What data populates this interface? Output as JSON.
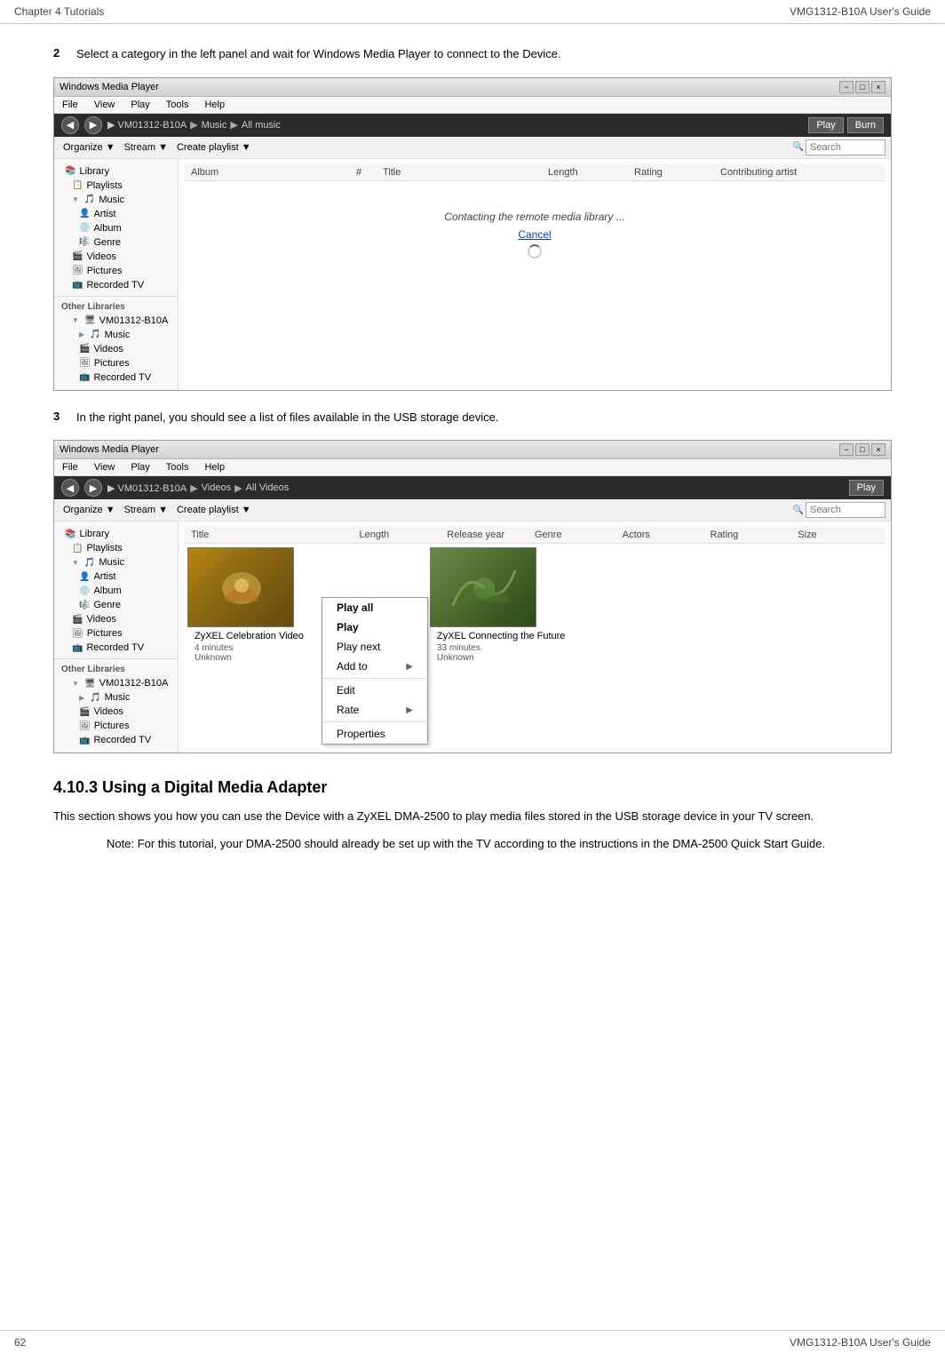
{
  "header": {
    "chapter": "Chapter 4 Tutorials",
    "product": "VMG1312-B10A User's Guide"
  },
  "footer": {
    "page": "62",
    "product": "VMG1312-B10A User's Guide"
  },
  "steps": {
    "step2": {
      "num": "2",
      "text": "Select a category in the left panel and wait for Windows Media Player to connect to the Device."
    },
    "step3": {
      "num": "3",
      "text": "In the right panel, you should see a list of files available in the USB storage device."
    }
  },
  "section": {
    "heading": "4.10.3  Using a Digital Media Adapter",
    "para1": "This section shows you how you can use the Device with a ZyXEL DMA-2500 to play media files stored in the USB storage device in your TV screen.",
    "note_label": "Note: ",
    "note_text": "For this tutorial, your DMA-2500 should already be set up with the TV according to the instructions in the DMA-2500 Quick Start Guide."
  },
  "wmp1": {
    "title": "Windows Media Player",
    "titlebar_minimize": "−",
    "titlebar_restore": "□",
    "titlebar_close": "×",
    "menu": [
      "File",
      "View",
      "Play",
      "Tools",
      "Help"
    ],
    "breadcrumb": [
      "VM01312-B10A",
      "Music",
      "All music"
    ],
    "btn_play": "Play",
    "btn_burn": "Burn",
    "toolbar_organize": "Organize ▼",
    "toolbar_stream": "Stream ▼",
    "toolbar_playlist": "Create playlist ▼",
    "search_placeholder": "Search",
    "col_headers": [
      "Album",
      "#",
      "Title",
      "Length",
      "Rating",
      "Contributing artist"
    ],
    "sidebar": {
      "library": "Library",
      "playlists": "Playlists",
      "music_label": "Music",
      "music_items": [
        "Artist",
        "Album",
        "Genre"
      ],
      "videos": "Videos",
      "pictures": "Pictures",
      "recorded_tv": "Recorded TV",
      "other_libraries": "Other Libraries",
      "device_name": "VM01312-B10A",
      "device_music": "Music",
      "device_videos": "Videos",
      "device_pictures": "Pictures",
      "device_tv": "Recorded TV"
    },
    "connecting_text": "Contacting the remote media library ...",
    "cancel_text": "Cancel"
  },
  "wmp2": {
    "title": "Windows Media Player",
    "titlebar_minimize": "−",
    "titlebar_restore": "□",
    "titlebar_close": "×",
    "menu": [
      "File",
      "View",
      "Play",
      "Tools",
      "Help"
    ],
    "breadcrumb": [
      "VM01312-B10A",
      "Videos",
      "All Videos"
    ],
    "btn_play": "Play",
    "toolbar_organize": "Organize ▼",
    "toolbar_stream": "Stream ▼",
    "toolbar_playlist": "Create playlist ▼",
    "search_placeholder": "Search",
    "col_headers": [
      "Title",
      "Length",
      "Release year",
      "Genre",
      "Actors",
      "Rating",
      "Size"
    ],
    "sidebar": {
      "library": "Library",
      "playlists": "Playlists",
      "music_label": "Music",
      "music_items": [
        "Artist",
        "Album",
        "Genre"
      ],
      "videos": "Videos",
      "pictures": "Pictures",
      "recorded_tv": "Recorded TV",
      "other_libraries": "Other Libraries",
      "device_name": "VM01312-B10A",
      "device_music": "Music",
      "device_videos": "Videos",
      "device_pictures": "Pictures",
      "device_tv": "Recorded TV"
    },
    "video1": {
      "title": "ZyXEL Celebration Video",
      "duration": "4 minutes",
      "extra": "Unknown"
    },
    "video2": {
      "title": "ZyXEL Connecting the Future",
      "duration": "33 minutes",
      "extra": "Unknown"
    },
    "context_menu": {
      "play_all": "Play all",
      "play": "Play",
      "play_next": "Play next",
      "add_to": "Add to",
      "edit": "Edit",
      "rate": "Rate",
      "properties": "Properties"
    }
  }
}
